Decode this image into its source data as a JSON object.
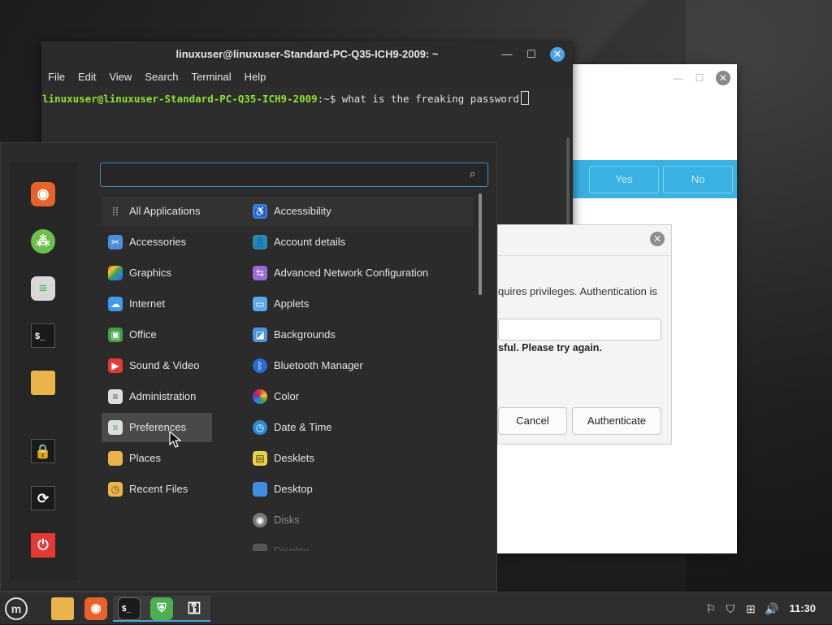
{
  "terminal": {
    "title": "linuxuser@linuxuser-Standard-PC-Q35-ICH9-2009: ~",
    "menu": [
      "File",
      "Edit",
      "View",
      "Search",
      "Terminal",
      "Help"
    ],
    "prompt": "linuxuser@linuxuser-Standard-PC-Q35-ICH9-2009",
    "path": ":~$",
    "command": " what is the freaking password"
  },
  "background_window": {
    "yes_label": "Yes",
    "no_label": "No"
  },
  "auth_dialog": {
    "message": "quires privileges. Authentication is",
    "error": "sful. Please try again.",
    "cancel_label": "Cancel",
    "authenticate_label": "Authenticate"
  },
  "menu": {
    "search_placeholder": "",
    "categories": [
      {
        "label": "All Applications",
        "icon": "grid-icon"
      },
      {
        "label": "Accessories",
        "icon": "scissors-icon"
      },
      {
        "label": "Graphics",
        "icon": "graphics-icon"
      },
      {
        "label": "Internet",
        "icon": "cloud-icon"
      },
      {
        "label": "Office",
        "icon": "office-icon"
      },
      {
        "label": "Sound & Video",
        "icon": "play-icon"
      },
      {
        "label": "Administration",
        "icon": "admin-icon"
      },
      {
        "label": "Preferences",
        "icon": "toggle-icon"
      },
      {
        "label": "Places",
        "icon": "folder-icon"
      },
      {
        "label": "Recent Files",
        "icon": "recent-folder-icon"
      }
    ],
    "apps": [
      {
        "label": "Accessibility",
        "icon": "accessibility-icon"
      },
      {
        "label": "Account details",
        "icon": "user-icon"
      },
      {
        "label": "Advanced Network Configuration",
        "icon": "network-icon"
      },
      {
        "label": "Applets",
        "icon": "applets-icon"
      },
      {
        "label": "Backgrounds",
        "icon": "backgrounds-icon"
      },
      {
        "label": "Bluetooth Manager",
        "icon": "bluetooth-icon"
      },
      {
        "label": "Color",
        "icon": "color-icon"
      },
      {
        "label": "Date & Time",
        "icon": "clock-icon"
      },
      {
        "label": "Desklets",
        "icon": "desklets-icon"
      },
      {
        "label": "Desktop",
        "icon": "desktop-icon"
      },
      {
        "label": "Disks",
        "icon": "disks-icon"
      },
      {
        "label": "Display",
        "icon": "display-icon"
      }
    ]
  },
  "favorites": [
    "firefox-icon",
    "software-manager-icon",
    "settings-icon",
    "terminal-icon",
    "files-icon",
    "lock-icon",
    "logout-icon",
    "power-icon"
  ],
  "taskbar": {
    "clock": "11:30",
    "items": [
      "mint-menu-icon",
      "files-icon",
      "firefox-icon",
      "terminal-icon",
      "update-shield-icon",
      "key-icon"
    ]
  },
  "colors": {
    "accent": "#4aa3df",
    "prompt_green": "#8ae234",
    "dialog_blue": "#39b1e3"
  }
}
